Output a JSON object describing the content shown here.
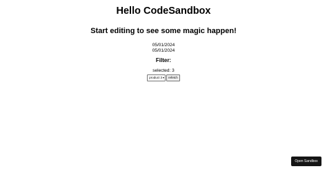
{
  "header": {
    "title": "Hello CodeSandbox",
    "subtitle": "Start editing to see some magic happen!"
  },
  "dates": [
    "05/01/2024",
    "05/01/2024"
  ],
  "filter": {
    "heading": "Filter:",
    "selected_text": "selected: 3",
    "select_value": "product 3",
    "refetch_label": "refetch"
  },
  "footer": {
    "open_sandbox_label": "Open Sandbox"
  },
  "icons": {
    "select_chevron": "chevron-down-icon"
  },
  "colors": {
    "open_sandbox_bg": "#151515",
    "open_sandbox_text": "#ffffff"
  }
}
